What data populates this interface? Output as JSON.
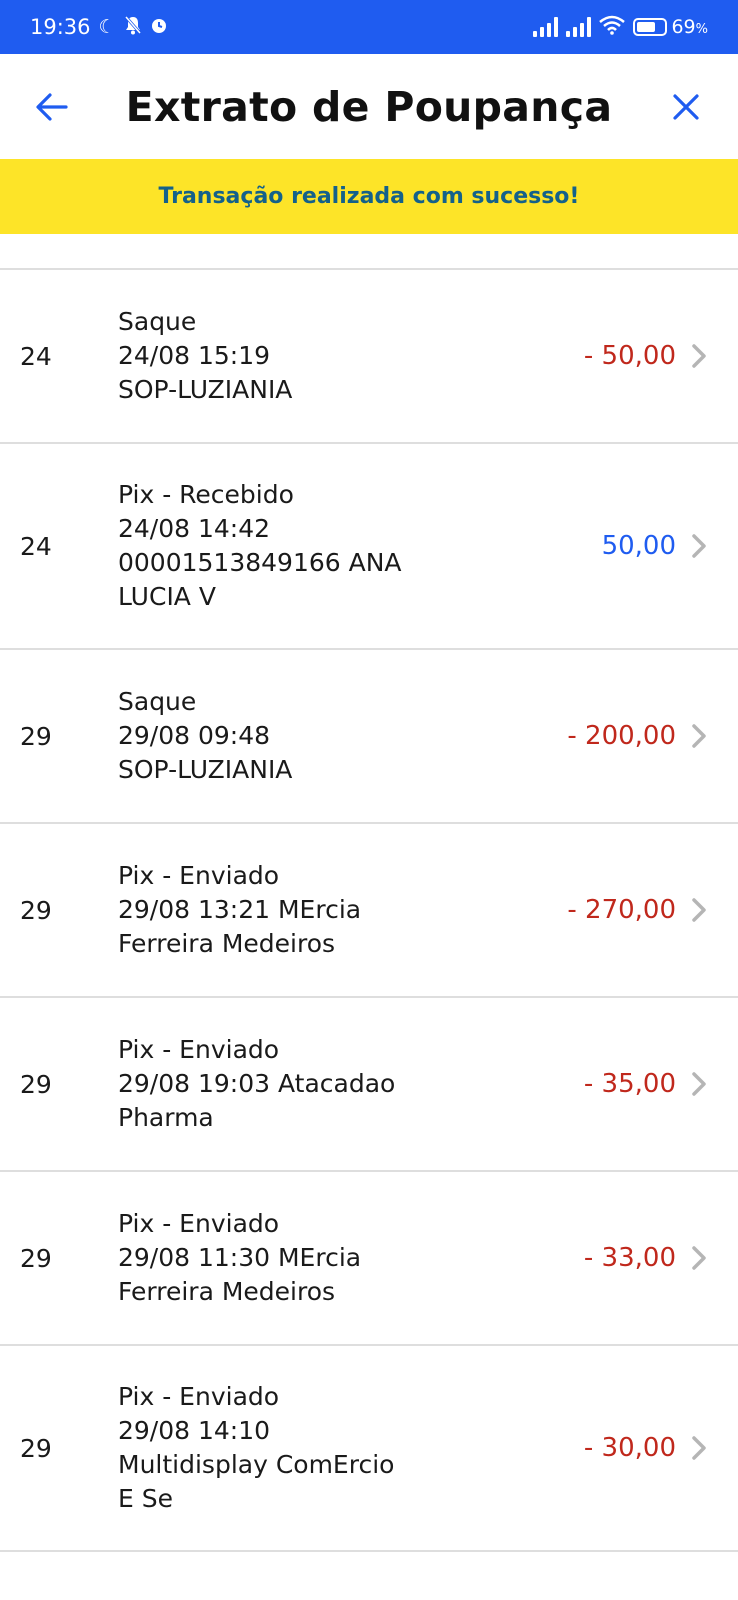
{
  "status_bar": {
    "time": "19:36",
    "battery": "69",
    "battery_unit": "%"
  },
  "header": {
    "title": "Extrato de Poupança"
  },
  "banner": {
    "message": "Transação realizada com sucesso!"
  },
  "colors": {
    "accent": "#1f5cf0",
    "banner_bg": "#fde428",
    "banner_text": "#14618a",
    "negative": "#c0281c",
    "positive": "#1f5cf0"
  },
  "transactions": [
    {
      "day": "24",
      "lines": [
        "Saque",
        "24/08 15:19",
        "SOP-LUZIANIA"
      ],
      "amount": "- 50,00",
      "type": "debit"
    },
    {
      "day": "24",
      "lines": [
        "Pix - Recebido",
        "24/08 14:42",
        "00001513849166 ANA",
        "LUCIA V"
      ],
      "amount": "50,00",
      "type": "credit"
    },
    {
      "day": "29",
      "lines": [
        "Saque",
        "29/08 09:48",
        "SOP-LUZIANIA"
      ],
      "amount": "- 200,00",
      "type": "debit"
    },
    {
      "day": "29",
      "lines": [
        "Pix - Enviado",
        "29/08 13:21 MErcia",
        "Ferreira Medeiros"
      ],
      "amount": "- 270,00",
      "type": "debit"
    },
    {
      "day": "29",
      "lines": [
        "Pix - Enviado",
        "29/08 19:03 Atacadao",
        "Pharma"
      ],
      "amount": "- 35,00",
      "type": "debit"
    },
    {
      "day": "29",
      "lines": [
        "Pix - Enviado",
        "29/08 11:30 MErcia",
        "Ferreira Medeiros"
      ],
      "amount": "- 33,00",
      "type": "debit"
    },
    {
      "day": "29",
      "lines": [
        "Pix - Enviado",
        "29/08 14:10",
        "Multidisplay ComErcio",
        "E Se"
      ],
      "amount": "- 30,00",
      "type": "debit"
    }
  ]
}
